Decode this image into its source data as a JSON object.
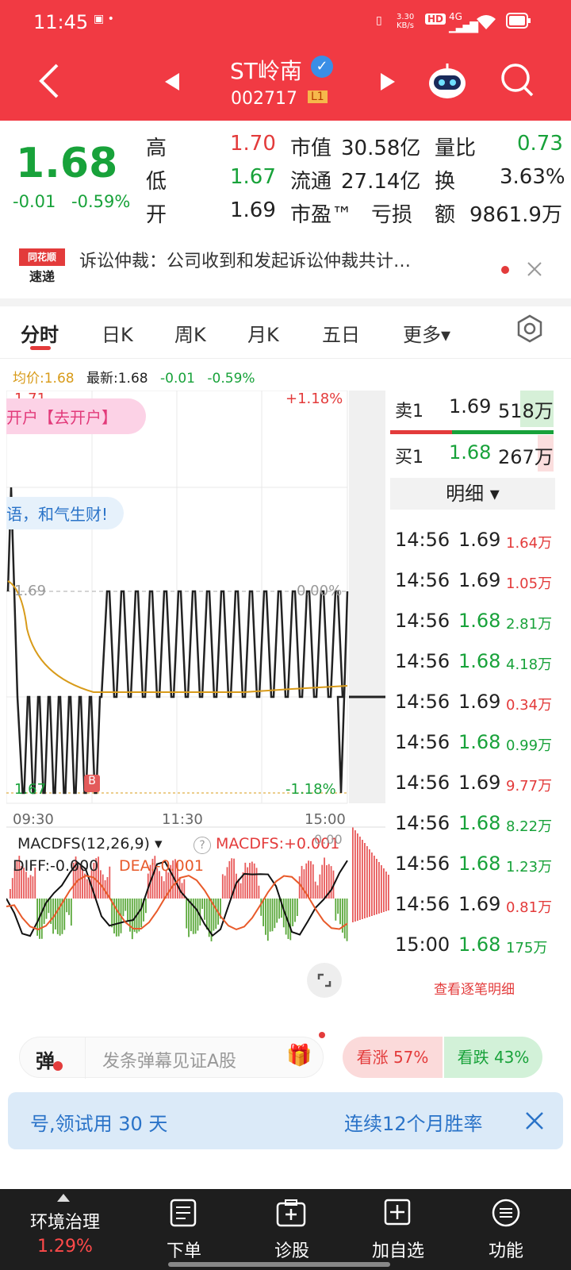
{
  "status": {
    "time": "11:45",
    "speed": "3.30\nKB/s",
    "net": "4G",
    "hd": "HD"
  },
  "header": {
    "title": "ST岭南",
    "code": "002717",
    "level": "L1"
  },
  "quote": {
    "price": "1.68",
    "change": "-0.01",
    "change_pct": "-0.59%",
    "rows": [
      {
        "k1": "高",
        "v1": "1.70",
        "k2": "市值",
        "v2": "30.58亿",
        "k3": "量比",
        "v3": "0.73"
      },
      {
        "k1": "低",
        "v1": "1.67",
        "k2": "流通",
        "v2": "27.14亿",
        "k3": "换",
        "v3": "3.63%"
      },
      {
        "k1": "开",
        "v1": "1.69",
        "k2": "市盈™",
        "v2": "亏损",
        "k3": "额",
        "v3": "9861.9万"
      }
    ]
  },
  "news": {
    "logo_top": "同花顺",
    "logo_bottom": "速递",
    "text": "诉讼仲裁：公司收到和发起诉讼仲裁共计…"
  },
  "tabs": [
    "分时",
    "日K",
    "周K",
    "月K",
    "五日",
    "更多▾"
  ],
  "infoline": {
    "avg": "均价:1.68",
    "last": "最新:1.68",
    "chg": "-0.01",
    "pct": "-0.59%"
  },
  "chart": {
    "top_price": "1.71",
    "top_pct": "+1.18%",
    "mid_price": "1.69",
    "mid_pct": "0.00%",
    "bot_price": "1.67",
    "bot_pct": "-1.18%",
    "times": [
      "09:30",
      "11:30",
      "15:00"
    ],
    "bubble1": "开户【去开户】",
    "bubble2": "语，和气生财!",
    "marker": "B",
    "macd_title": "MACDFS(12,26,9) ▾",
    "macd_val": "MACDFS:+0.001",
    "diff": "DIFF:-0.000",
    "dea": "DEA:-0.001",
    "zero": "0.00"
  },
  "orderbook": {
    "sell_label": "卖1",
    "sell_price": "1.69",
    "sell_vol": "518万",
    "buy_label": "买1",
    "buy_price": "1.68",
    "buy_vol": "267万",
    "detail": "明细 ▾",
    "more": "查看逐笔明细",
    "ticks": [
      {
        "t": "14:56",
        "p": "1.69",
        "v": "1.64万",
        "c": "red"
      },
      {
        "t": "14:56",
        "p": "1.69",
        "v": "1.05万",
        "c": "red"
      },
      {
        "t": "14:56",
        "p": "1.68",
        "v": "2.81万",
        "c": "green"
      },
      {
        "t": "14:56",
        "p": "1.68",
        "v": "4.18万",
        "c": "green"
      },
      {
        "t": "14:56",
        "p": "1.69",
        "v": "0.34万",
        "c": "red"
      },
      {
        "t": "14:56",
        "p": "1.68",
        "v": "0.99万",
        "c": "green"
      },
      {
        "t": "14:56",
        "p": "1.69",
        "v": "9.77万",
        "c": "red"
      },
      {
        "t": "14:56",
        "p": "1.68",
        "v": "8.22万",
        "c": "green"
      },
      {
        "t": "14:56",
        "p": "1.68",
        "v": "1.23万",
        "c": "green"
      },
      {
        "t": "14:56",
        "p": "1.69",
        "v": "0.81万",
        "c": "red"
      },
      {
        "t": "15:00",
        "p": "1.68",
        "v": "175万",
        "c": "green"
      }
    ]
  },
  "danmu": {
    "icon": "弹",
    "placeholder": "发条弹幕见证A股",
    "up": "看涨 57%",
    "down": "看跌 43%"
  },
  "banner": {
    "left": "号,领试用 30 天",
    "right": "连续12个月胜率"
  },
  "bottomnav": {
    "sector": "环境治理",
    "sector_pct": "1.29%",
    "items": [
      "下单",
      "诊股",
      "加自选",
      "功能"
    ]
  }
}
